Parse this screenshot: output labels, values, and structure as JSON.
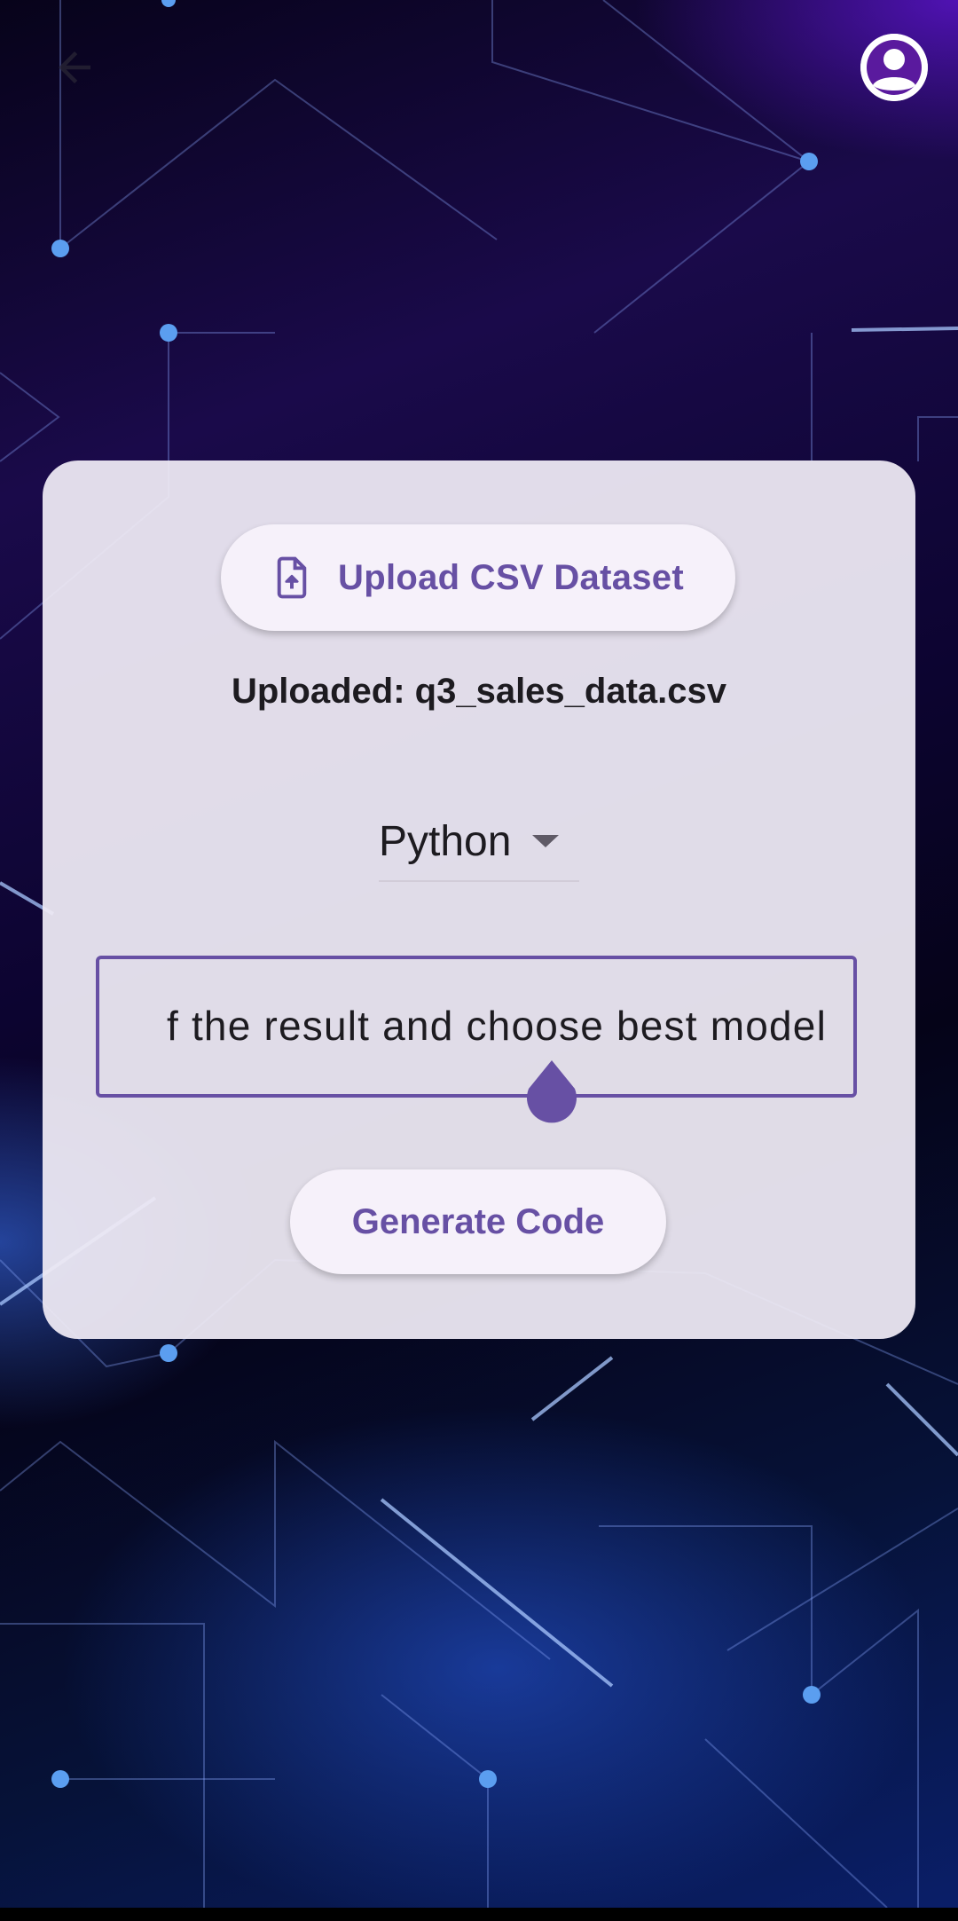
{
  "header": {
    "back_icon": "arrow-back-icon",
    "profile_icon": "account-circle-icon"
  },
  "upload": {
    "label": "Upload CSV Dataset",
    "icon": "file-upload-icon",
    "status": "Uploaded: q3_sales_data.csv"
  },
  "language": {
    "selected": "Python",
    "icon": "dropdown-arrow-icon"
  },
  "prompt": {
    "value": "f the result and choose best model"
  },
  "actions": {
    "generate_label": "Generate Code"
  },
  "colors": {
    "accent": "#6750a4",
    "card_background": "#eeeaf4",
    "button_background": "#f6f1fa",
    "text": "#1d1b20"
  }
}
